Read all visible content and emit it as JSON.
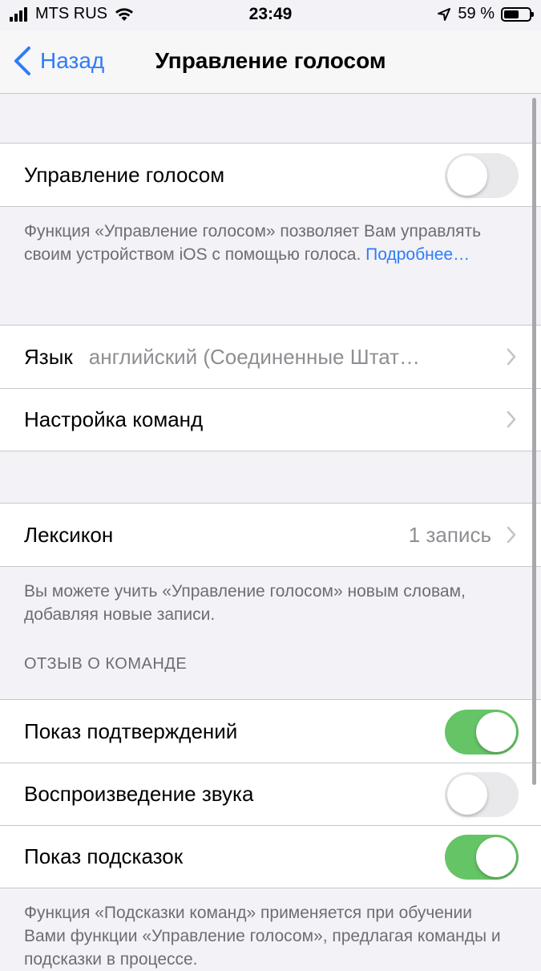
{
  "status_bar": {
    "carrier": "MTS RUS",
    "time": "23:49",
    "battery_percent": "59 %",
    "battery_level": 0.59
  },
  "nav": {
    "back_label": "Назад",
    "title": "Управление голосом"
  },
  "voice_control": {
    "label": "Управление голосом",
    "enabled": false,
    "description": "Функция «Управление голосом» позволяет Вам управлять своим устройством iOS с помощью голоса.",
    "more_link": "Подробнее…"
  },
  "language": {
    "label": "Язык",
    "value": "английский (Соединенные Штат…"
  },
  "customize_commands": {
    "label": "Настройка команд"
  },
  "vocabulary": {
    "label": "Лексикон",
    "value": "1 запись",
    "description": "Вы можете учить «Управление голосом» новым словам, добавляя новые записи."
  },
  "feedback": {
    "header": "ОТЗЫВ О КОМАНДЕ",
    "show_confirmation": {
      "label": "Показ подтверждений",
      "enabled": true
    },
    "play_sound": {
      "label": "Воспроизведение звука",
      "enabled": false
    },
    "show_hints": {
      "label": "Показ подсказок",
      "enabled": true
    },
    "description": "Функция «Подсказки команд» применяется при обучении Вами функции «Управление голосом», предлагая команды и подсказки в процессе."
  },
  "colors": {
    "accent": "#2f7cf6",
    "toggle_on": "#65c466",
    "toggle_off": "#e9e9eb",
    "background": "#f2f2f7"
  }
}
